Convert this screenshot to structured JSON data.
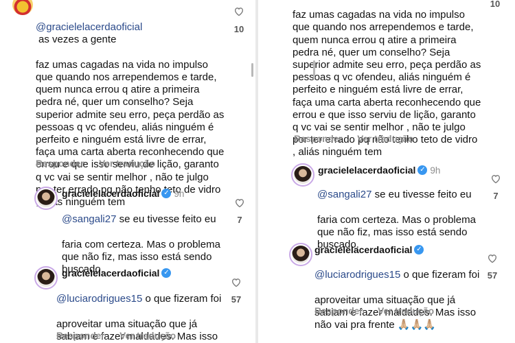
{
  "left": {
    "comment": {
      "username": "@gracielelacerdaoficial",
      "text_first": "as vezes a gente",
      "text_rest": "faz umas cagadas na vida no impulso\nque quando nos arrependemos e tarde,\nquem nunca errou q atire a primeira\npedra né, quer um conselho? Seja\nsuperior admite seu erro, peça perdão as\npessoas q vc ofendeu, aliás ninguém é\nperfeito e ninguém está livre de errar,\nfaça uma carta aberta reconhecendo que\nerrou e que isso serviu de lição, garanto\nq vc vai se sentir melhor , não te julgo\npor ter errado pq não tenho teto de vidro\n, aliás ninguém tem",
      "likes": "10",
      "reply_label": "Responder",
      "translate_label": "Ver tradução"
    },
    "reply1": {
      "username": "gracielelacerdaoficial",
      "time": "9h",
      "mention": "@sangali27",
      "text_first": " se eu tivesse feito eu",
      "text_rest": "faria com certeza. Mas o problema\nque não fiz, mas isso está sendo\nbuscado.",
      "likes": "7"
    },
    "reply2": {
      "username": "gracielelacerdaoficial",
      "mention": "@luciarodrigues15",
      "text_first": " o que fizeram foi",
      "text_rest": "aproveitar uma situação que já\nsabiam e fazer maldades. Mas isso\nnão vai pra frente 🙏🏼🙏🏼🙏🏼",
      "likes": "57",
      "reply_label": "Responder",
      "translate_label": "Ver tradução"
    }
  },
  "right": {
    "comment": {
      "text": "faz umas cagadas na vida no impulso\nque quando nos arrependemos e tarde,\nquem nunca errou q atire a primeira\npedra né, quer um conselho? Seja\nsuperior admite seu erro, peça perdão as\npessoas q vc ofendeu, aliás ninguém é\nperfeito e ninguém está livre de errar,\nfaça uma carta aberta reconhecendo que\nerrou e que isso serviu de lição, garanto\nq vc vai se sentir melhor , não te julgo\npor ter errado pq não tenho teto de vidro\n, aliás ninguém tem",
      "likes": "10",
      "reply_label": "Responder",
      "translate_label": "Ver tradução"
    },
    "reply1": {
      "username": "gracielelacerdaoficial",
      "time": "9h",
      "mention": "@sangali27",
      "text_first": " se eu tivesse feito eu",
      "text_rest": "faria com certeza. Mas o problema\nque não fiz, mas isso está sendo\nbuscado.",
      "likes": "7"
    },
    "reply2": {
      "username": "gracielelacerdaoficial",
      "mention": "@luciarodrigues15",
      "text_first": " o que fizeram foi",
      "text_rest": "aproveitar uma situação que já\nsabiam e fazer maldades. Mas isso\nnão vai pra frente 🙏🏼🙏🏼🙏🏼",
      "likes": "57",
      "reply_label": "Responder",
      "translate_label": "Ver tradução"
    }
  },
  "icons": {
    "like": "heart-outline-icon",
    "verified": "verified-badge-icon"
  },
  "colors": {
    "mention": "#2b4a8a",
    "muted": "#8e8e8e",
    "verified": "#3897f0"
  }
}
